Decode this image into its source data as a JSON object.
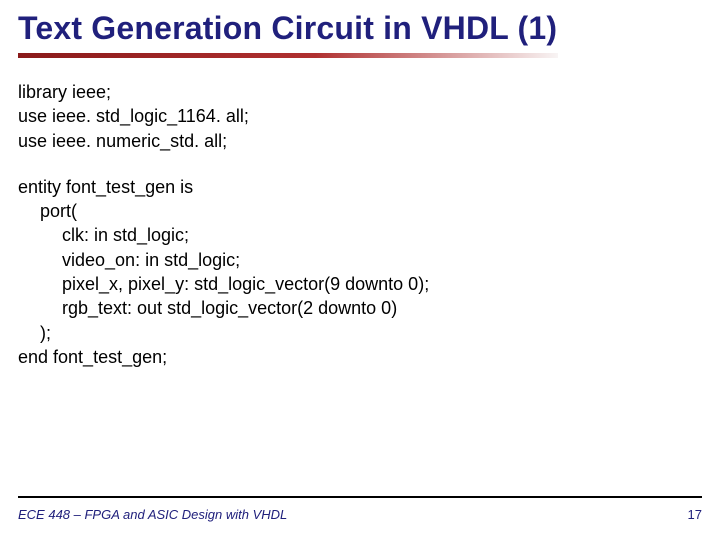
{
  "title": "Text Generation Circuit in VHDL (1)",
  "code": {
    "l1": "library ieee;",
    "l2": "use ieee. std_logic_1164. all;",
    "l3": "use ieee. numeric_std. all;",
    "l4": "entity font_test_gen is",
    "l5": "port(",
    "l6": "clk: in std_logic;",
    "l7": "video_on: in std_logic;",
    "l8": "pixel_x, pixel_y: std_logic_vector(9 downto 0);",
    "l9": "rgb_text: out std_logic_vector(2 downto 0)",
    "l10": ");",
    "l11": "end font_test_gen;"
  },
  "footer": "ECE 448 – FPGA and ASIC Design with VHDL",
  "page": "17"
}
